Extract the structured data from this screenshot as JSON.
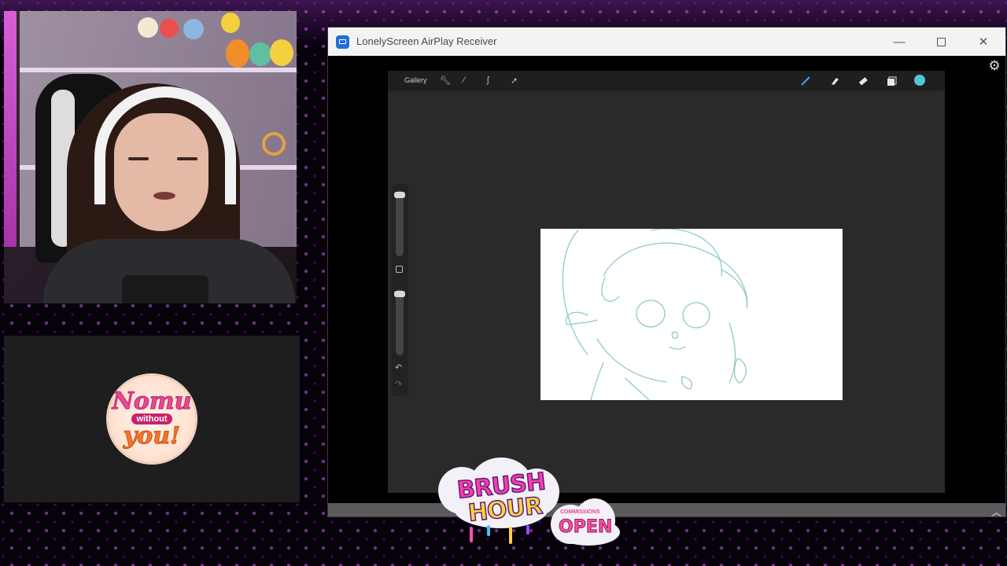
{
  "app_window": {
    "title": "LonelyScreen AirPlay Receiver",
    "controls": {
      "minimize": "—",
      "close": "✕"
    },
    "settings_icon": "gear-icon"
  },
  "procreate": {
    "toolbar": {
      "gallery_label": "Gallery",
      "left_tools": [
        "wrench-icon",
        "magic-wand-icon",
        "selection-icon",
        "transform-icon"
      ],
      "right_tools": [
        "brush-icon",
        "smudge-icon",
        "eraser-icon",
        "layers-icon",
        "color-icon"
      ],
      "active_color": "#53c6d8"
    },
    "sidebar": {
      "undo_icon": "↶",
      "redo_icon": "↷"
    }
  },
  "overlay": {
    "logo": {
      "line1": "Nomu",
      "line2": "without",
      "line3": "you!"
    },
    "brush_hour": {
      "line1": "BRUSH",
      "line2": "HOUR"
    },
    "commissions": {
      "top": "COMMISSIONS",
      "main": "OPEN"
    }
  },
  "colors": {
    "accent_purple": "#c84bff",
    "sketch_line": "#8fc9c8"
  }
}
